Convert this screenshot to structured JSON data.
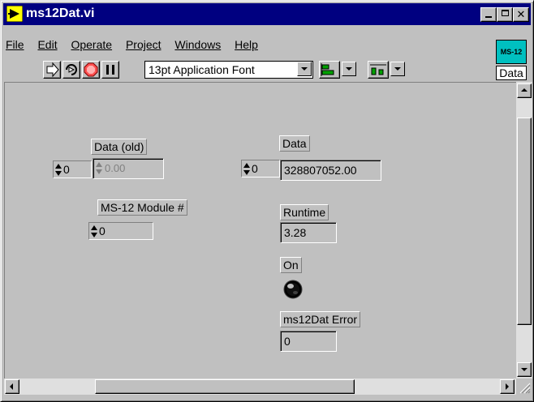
{
  "window": {
    "title": "ms12Dat.vi",
    "icon": "labview-vi-icon",
    "controls": [
      "minimize-icon",
      "maximize-icon",
      "close-icon"
    ]
  },
  "menu": {
    "items": [
      {
        "label": "File"
      },
      {
        "label": "Edit"
      },
      {
        "label": "Operate"
      },
      {
        "label": "Project"
      },
      {
        "label": "Windows"
      },
      {
        "label": "Help"
      }
    ]
  },
  "toolbar": {
    "font": "13pt Application Font",
    "buttons": [
      "run-arrow-icon",
      "run-continuous-icon",
      "abort-stop-icon",
      "pause-icon"
    ]
  },
  "vi_icon": {
    "text": "MS-12",
    "label": "Data",
    "color": "#00c0c0"
  },
  "front_panel": {
    "data_old": {
      "label": "Data (old)",
      "index": "0",
      "value": "0.00"
    },
    "module": {
      "label": "MS-12 Module #",
      "value": "0"
    },
    "data": {
      "label": "Data",
      "index": "0",
      "value": "328807052.00"
    },
    "runtime": {
      "label": "Runtime",
      "value": "3.28"
    },
    "on": {
      "label": "On"
    },
    "error": {
      "label": "ms12Dat Error",
      "value": "0"
    }
  }
}
